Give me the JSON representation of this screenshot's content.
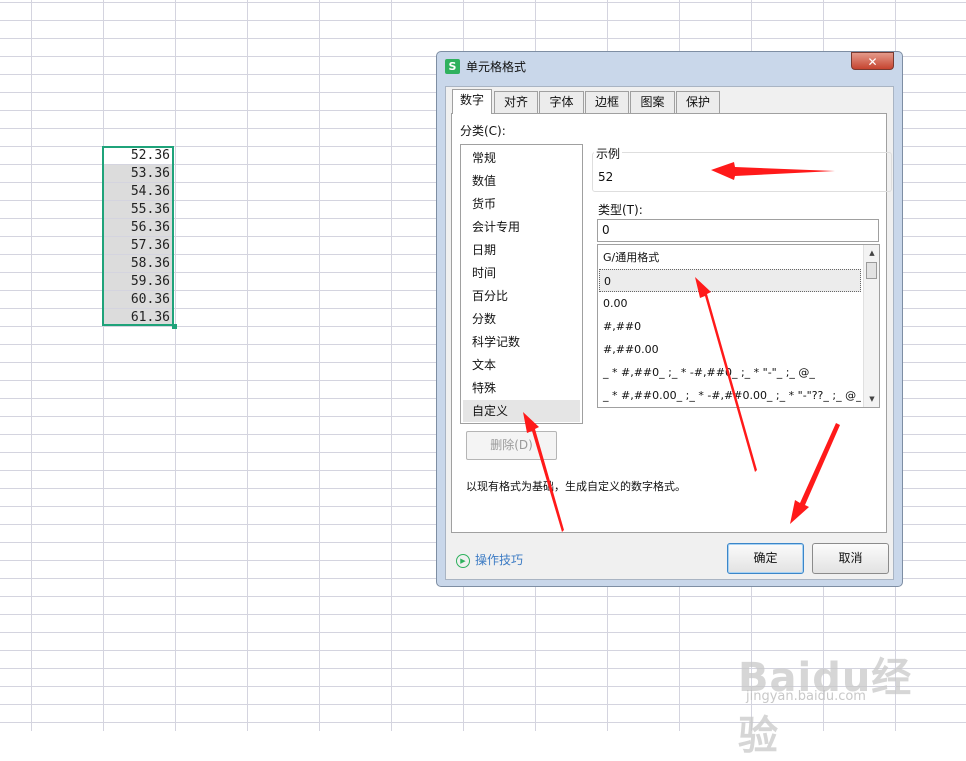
{
  "sheet": {
    "cells": [
      "52.36",
      "53.36",
      "54.36",
      "55.36",
      "56.36",
      "57.36",
      "58.36",
      "59.36",
      "60.36",
      "61.36"
    ]
  },
  "dialog": {
    "title": "单元格格式",
    "close_glyph": "✕",
    "app_logo": "S",
    "tabs": [
      {
        "label": "数字",
        "active": true
      },
      {
        "label": "对齐"
      },
      {
        "label": "字体"
      },
      {
        "label": "边框"
      },
      {
        "label": "图案"
      },
      {
        "label": "保护"
      }
    ],
    "category_label": "分类(C):",
    "categories": [
      "常规",
      "数值",
      "货币",
      "会计专用",
      "日期",
      "时间",
      "百分比",
      "分数",
      "科学记数",
      "文本",
      "特殊",
      "自定义"
    ],
    "selected_category": "自定义",
    "sample_label": "示例",
    "sample_value": "52",
    "type_label": "类型(T):",
    "type_value": "0",
    "formats": [
      "G/通用格式",
      "0",
      "0.00",
      "#,##0",
      "#,##0.00",
      "_ * #,##0_ ;_ * -#,##0_ ;_ * \"-\"_ ;_ @_",
      "_ * #,##0.00_ ;_ * -#,##0.00_ ;_ * \"-\"??_ ;_ @_"
    ],
    "selected_format": "0",
    "delete_button": "删除(D)",
    "hint": "以现有格式为基础，生成自定义的数字格式。",
    "tips_link": "操作技巧",
    "ok_button": "确定",
    "cancel_button": "取消"
  },
  "watermark": {
    "logo": "Baidu经验",
    "url": "jingyan.baidu.com"
  },
  "colors": {
    "selection_border": "#1fa37a",
    "annotation_arrow": "#ff1a1a",
    "link": "#3c7bc4"
  }
}
